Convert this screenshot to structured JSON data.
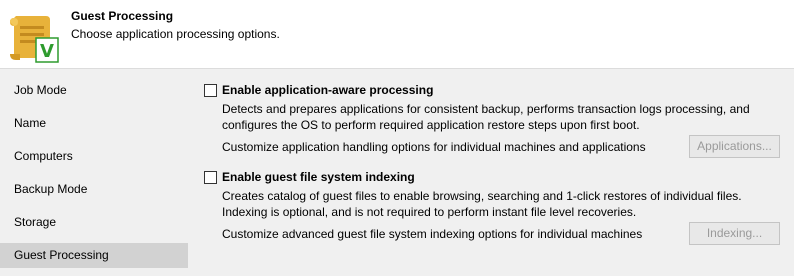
{
  "header": {
    "title": "Guest Processing",
    "subtitle": "Choose application processing options."
  },
  "sidebar": {
    "items": [
      {
        "label": "Job Mode"
      },
      {
        "label": "Name"
      },
      {
        "label": "Computers"
      },
      {
        "label": "Backup Mode"
      },
      {
        "label": "Storage"
      },
      {
        "label": "Guest Processing",
        "active": true
      }
    ]
  },
  "main": {
    "app_aware": {
      "checked": false,
      "label": "Enable application-aware processing",
      "description_line1": "Detects and prepares applications for consistent backup, performs transaction logs processing, and",
      "description_line2": "configures the OS to perform required application restore steps upon first boot.",
      "customize_text": "Customize application handling options for individual machines and applications",
      "button_label": "Applications..."
    },
    "fs_indexing": {
      "checked": false,
      "label": "Enable guest file system indexing",
      "description_line1": "Creates catalog of guest files to enable browsing, searching and 1-click restores of individual files.",
      "description_line2": "Indexing is optional, and is not required to perform instant file level recoveries.",
      "customize_text": "Customize advanced guest file system indexing options for individual machines",
      "button_label": "Indexing..."
    }
  },
  "colors": {
    "header_bg": "#ffffff",
    "panel_bg": "#f0f0f0",
    "active_nav": "#d2d2d2",
    "scroll_yellow": "#e8b23a",
    "check_green": "#2e9b2e"
  },
  "icons": {
    "logo": "scroll-with-green-check-icon"
  }
}
